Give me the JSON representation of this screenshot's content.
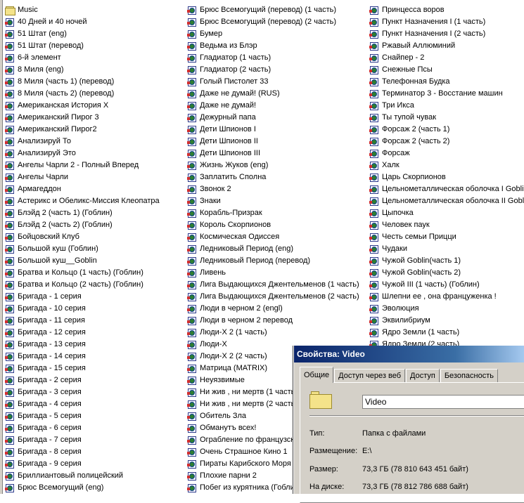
{
  "file_list": {
    "columns": [
      [
        {
          "label": "Music",
          "icon": "folder-icon"
        },
        {
          "label": "40 Дней и 40 ночей",
          "icon": "video-file-icon"
        },
        {
          "label": "51 Штат (eng)",
          "icon": "video-file-icon"
        },
        {
          "label": "51 Штат (перевод)",
          "icon": "video-file-icon"
        },
        {
          "label": "6-й элемент",
          "icon": "video-file-icon"
        },
        {
          "label": "8 Миля (eng)",
          "icon": "video-file-icon"
        },
        {
          "label": "8 Миля (часть 1) (перевод)",
          "icon": "video-file-icon"
        },
        {
          "label": "8 Миля (часть 2) (перевод)",
          "icon": "video-file-icon"
        },
        {
          "label": "Американская История X",
          "icon": "video-file-icon"
        },
        {
          "label": "Американский Пирог 3",
          "icon": "video-file-icon"
        },
        {
          "label": "Американский Пирог2",
          "icon": "video-file-icon"
        },
        {
          "label": "Анализируй То",
          "icon": "video-file-icon"
        },
        {
          "label": "Анализируй Это",
          "icon": "video-file-icon"
        },
        {
          "label": "Ангелы Чарли 2 - Полный Вперед",
          "icon": "video-file-icon"
        },
        {
          "label": "Ангелы Чарли",
          "icon": "video-file-icon"
        },
        {
          "label": "Армагеддон",
          "icon": "video-file-icon"
        },
        {
          "label": "Астерикс и Обеликс-Миссия Клеопатра",
          "icon": "video-file-icon"
        },
        {
          "label": "Блэйд 2 (часть 1) (Гоблин)",
          "icon": "video-file-icon"
        },
        {
          "label": "Блэйд 2 (часть 2) (Гоблин)",
          "icon": "video-file-icon"
        },
        {
          "label": "Бойцовский Клуб",
          "icon": "video-file-icon"
        },
        {
          "label": "Большой куш (Гоблин)",
          "icon": "video-file-icon"
        },
        {
          "label": "Большой куш__Goblin",
          "icon": "video-file-icon"
        },
        {
          "label": "Братва и Кольцо (1 часть) (Гоблин)",
          "icon": "video-file-icon"
        },
        {
          "label": "Братва и Кольцо (2 часть) (Гоблин)",
          "icon": "video-file-icon"
        },
        {
          "label": "Бригада - 1 серия",
          "icon": "video-file-icon"
        },
        {
          "label": "Бригада - 10 серия",
          "icon": "video-file-icon"
        },
        {
          "label": "Бригада - 11 серия",
          "icon": "video-file-icon"
        },
        {
          "label": "Бригада - 12 серия",
          "icon": "video-file-icon"
        },
        {
          "label": "Бригада - 13 серия",
          "icon": "video-file-icon"
        },
        {
          "label": "Бригада - 14 серия",
          "icon": "video-file-icon"
        },
        {
          "label": "Бригада - 15 серия",
          "icon": "video-file-icon"
        },
        {
          "label": "Бригада - 2 серия",
          "icon": "video-file-icon"
        },
        {
          "label": "Бригада - 3 серия",
          "icon": "video-file-icon"
        },
        {
          "label": "Бригада - 4 серия",
          "icon": "video-file-icon"
        },
        {
          "label": "Бригада - 5 серия",
          "icon": "video-file-icon"
        },
        {
          "label": "Бригада - 6 серия",
          "icon": "video-file-icon"
        },
        {
          "label": "Бригада - 7 серия",
          "icon": "video-file-icon"
        },
        {
          "label": "Бригада - 8 серия",
          "icon": "video-file-icon"
        },
        {
          "label": "Бригада - 9 серия",
          "icon": "video-file-icon"
        },
        {
          "label": "Бриллиантовый полицейский",
          "icon": "video-file-icon"
        },
        {
          "label": "Брюс Всемогущий (eng)",
          "icon": "video-file-icon"
        }
      ],
      [
        {
          "label": "Брюс Всемогущий (перевод) (1 часть)",
          "icon": "video-file-icon"
        },
        {
          "label": "Брюс Всемогущий (перевод) (2 часть)",
          "icon": "video-file-icon"
        },
        {
          "label": "Бумер",
          "icon": "video-file-icon"
        },
        {
          "label": "Ведьма из Блэр",
          "icon": "video-file-icon"
        },
        {
          "label": "Гладиатор (1 часть)",
          "icon": "video-file-icon"
        },
        {
          "label": "Гладиатор (2 часть)",
          "icon": "video-file-icon"
        },
        {
          "label": "Голый Пистолет 33",
          "icon": "video-file-icon"
        },
        {
          "label": "Даже не думай! (RUS)",
          "icon": "video-file-icon"
        },
        {
          "label": "Даже не думай!",
          "icon": "video-file-icon"
        },
        {
          "label": "Дежурный папа",
          "icon": "video-file-icon"
        },
        {
          "label": "Дети Шпионов I",
          "icon": "video-file-icon"
        },
        {
          "label": "Дети Шпионов II",
          "icon": "video-file-icon"
        },
        {
          "label": "Дети Шпионов III",
          "icon": "video-file-icon"
        },
        {
          "label": "Жизнь Жуков (eng)",
          "icon": "video-file-icon"
        },
        {
          "label": "Заплатить Сполна",
          "icon": "video-file-icon"
        },
        {
          "label": "Звонок 2",
          "icon": "video-file-icon"
        },
        {
          "label": "Знаки",
          "icon": "video-file-icon"
        },
        {
          "label": "Корабль-Призрак",
          "icon": "video-file-icon"
        },
        {
          "label": "Король Скорпионов",
          "icon": "video-file-icon"
        },
        {
          "label": "Космическая Одиссея",
          "icon": "video-file-icon"
        },
        {
          "label": "Ледниковый Период (eng)",
          "icon": "video-file-icon"
        },
        {
          "label": "Ледниковый Период (перевод)",
          "icon": "video-file-icon"
        },
        {
          "label": "Ливень",
          "icon": "video-file-icon"
        },
        {
          "label": "Лига Выдающихся Джентельменов (1 часть)",
          "icon": "video-file-icon"
        },
        {
          "label": "Лига Выдающихся Джентельменов (2 часть)",
          "icon": "video-file-icon"
        },
        {
          "label": "Люди в черном 2 (engl)",
          "icon": "video-file-icon"
        },
        {
          "label": "Люди в черном 2 перевод",
          "icon": "video-file-icon"
        },
        {
          "label": "Люди-Х 2 (1 часть)",
          "icon": "video-file-icon"
        },
        {
          "label": "Люди-Х",
          "icon": "video-file-icon"
        },
        {
          "label": "Люди-Х 2 (2 часть)",
          "icon": "video-file-icon"
        },
        {
          "label": "Матрица (MATRIX)",
          "icon": "video-file-icon"
        },
        {
          "label": "Неуязвимые",
          "icon": "video-file-icon"
        },
        {
          "label": "Ни жив , ни мертв (1 часть)",
          "icon": "video-file-icon"
        },
        {
          "label": "Ни жив , ни мертв (2 часть)",
          "icon": "video-file-icon"
        },
        {
          "label": "Обитель Зла",
          "icon": "video-file-icon"
        },
        {
          "label": "Обманутъ всех!",
          "icon": "video-file-icon"
        },
        {
          "label": "Ограбление по французски",
          "icon": "video-file-icon"
        },
        {
          "label": "Очень Страшное Кино 1",
          "icon": "video-file-icon"
        },
        {
          "label": "Пираты Карибского Моря",
          "icon": "video-file-icon"
        },
        {
          "label": "Плохие парни 2",
          "icon": "video-file-icon"
        },
        {
          "label": "Побег из курятника (Гоблин)",
          "icon": "video-file-icon"
        }
      ],
      [
        {
          "label": "Принцесса воров",
          "icon": "video-file-icon"
        },
        {
          "label": "Пункт Назначения I (1 часть)",
          "icon": "video-file-icon"
        },
        {
          "label": "Пункт Назначения I (2 часть)",
          "icon": "video-file-icon"
        },
        {
          "label": "Ржавый Аллюминий",
          "icon": "video-file-icon"
        },
        {
          "label": "Снайпер - 2",
          "icon": "video-file-icon"
        },
        {
          "label": "Снежные Псы",
          "icon": "video-file-icon"
        },
        {
          "label": "Телефонная Будка",
          "icon": "video-file-icon"
        },
        {
          "label": "Терминатор 3 - Восстание машин",
          "icon": "video-file-icon"
        },
        {
          "label": "Три Икса",
          "icon": "video-file-icon"
        },
        {
          "label": "Ты тупой чувак",
          "icon": "video-file-icon"
        },
        {
          "label": "Форсаж 2 (часть 1)",
          "icon": "video-file-icon"
        },
        {
          "label": "Форсаж 2 (часть 2)",
          "icon": "video-file-icon"
        },
        {
          "label": "Форсаж",
          "icon": "video-file-icon"
        },
        {
          "label": "Халк",
          "icon": "video-file-icon"
        },
        {
          "label": "Царь Скорпионов",
          "icon": "video-file-icon"
        },
        {
          "label": "Цельнометаллическая оболочка I Goblin",
          "icon": "video-file-icon"
        },
        {
          "label": "Цельнометаллическая оболочка II Goblin",
          "icon": "video-file-icon"
        },
        {
          "label": "Цыпочка",
          "icon": "video-file-icon"
        },
        {
          "label": "Человек паук",
          "icon": "video-file-icon"
        },
        {
          "label": "Честь семьи Прицци",
          "icon": "video-file-icon"
        },
        {
          "label": "Чудаки",
          "icon": "video-file-icon"
        },
        {
          "label": "Чужой Goblin(часть 1)",
          "icon": "video-file-icon"
        },
        {
          "label": "Чужой Goblin(часть 2)",
          "icon": "video-file-icon"
        },
        {
          "label": "Чужой III (1 часть) (Гоблин)",
          "icon": "video-file-icon"
        },
        {
          "label": "Шлепни ее , она француженка !",
          "icon": "video-file-icon"
        },
        {
          "label": "Эволюция",
          "icon": "video-file-icon"
        },
        {
          "label": "Эквилибриум",
          "icon": "video-file-icon"
        },
        {
          "label": "Ядро Земли (1 часть)",
          "icon": "video-file-icon"
        },
        {
          "label": "Ядро Земли (2 часть)",
          "icon": "video-file-icon"
        }
      ]
    ]
  },
  "dialog": {
    "title": "Свойства: Video",
    "tabs": [
      "Общие",
      "Доступ через веб",
      "Доступ",
      "Безопасность"
    ],
    "name_value": "Video",
    "properties": [
      {
        "label": "Тип:",
        "value": "Папка с файлами"
      },
      {
        "label": "Размещение:",
        "value": "E:\\"
      },
      {
        "label": "Размер:",
        "value": "73,3 ГБ (78 810 643 451 байт)"
      },
      {
        "label": "На диске:",
        "value": "73,3 ГБ (78 812 786 688 байт)"
      }
    ]
  },
  "colors": {
    "title_bar": "#0a246a",
    "dialog_bg": "#d4d0c8",
    "folder": "#f4e38a"
  }
}
